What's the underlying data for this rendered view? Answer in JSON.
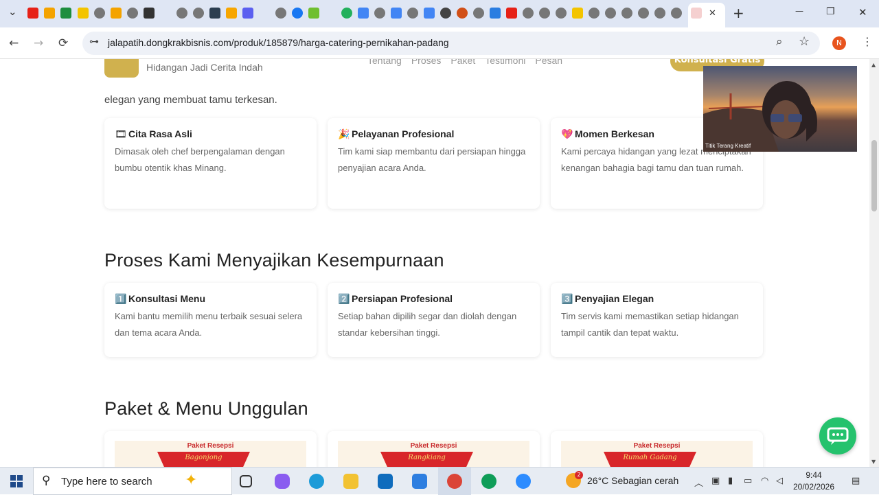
{
  "browser": {
    "url": "jalapatih.dongkrakbisnis.com/produk/185879/harga-catering-pernikahan-padang",
    "user_initial": "N",
    "controls": {
      "back": "←",
      "forward": "→",
      "reload": "⟳",
      "tune": "⊶",
      "zoom": "⌕",
      "star": "☆",
      "new_tab": "+",
      "minimize": "—",
      "restore": "❐",
      "close": "✕",
      "tab_menu": "⌄",
      "tab_close": "✕"
    }
  },
  "site": {
    "tagline": "Hidangan Jadi Cerita Indah",
    "nav": [
      "Tentang",
      "Proses",
      "Paket",
      "Testimoni",
      "Pesan"
    ],
    "cta": "Konsultasi Gratis"
  },
  "intro_tail": "elegan yang membuat tamu terkesan.",
  "features": [
    {
      "emoji": "🎞",
      "title": "Cita Rasa Asli",
      "text": "Dimasak oleh chef berpengalaman dengan bumbu otentik khas Minang."
    },
    {
      "emoji": "🎉",
      "title": "Pelayanan Profesional",
      "text": "Tim kami siap membantu dari persiapan hingga penyajian acara Anda."
    },
    {
      "emoji": "💖",
      "title": "Momen Berkesan",
      "text": "Kami percaya hidangan yang lezat menciptakan kenangan bahagia bagi tamu dan tuan rumah."
    }
  ],
  "process_title": "Proses Kami Menyajikan Kesempurnaan",
  "process": [
    {
      "emoji": "1️⃣",
      "title": "Konsultasi Menu",
      "text": "Kami bantu memilih menu terbaik sesuai selera dan tema acara Anda."
    },
    {
      "emoji": "2️⃣",
      "title": "Persiapan Profesional",
      "text": "Setiap bahan dipilih segar dan diolah dengan standar kebersihan tinggi."
    },
    {
      "emoji": "3️⃣",
      "title": "Penyajian Elegan",
      "text": "Tim servis kami memastikan setiap hidangan tampil cantik dan tepat waktu."
    }
  ],
  "packages_title": "Paket & Menu Unggulan",
  "packages": [
    {
      "label": "Paket Resepsi",
      "name": "Bagonjong"
    },
    {
      "label": "Paket Resepsi",
      "name": "Rangkiang"
    },
    {
      "label": "Paket Resepsi",
      "name": "Rumah Gadang"
    }
  ],
  "video_caption": "Titik Terang Kreatif",
  "taskbar": {
    "search_placeholder": "Type here to search",
    "weather": "26°C  Sebagian cerah",
    "weather_badge": "2",
    "time": "9:44",
    "date": "20/02/2026"
  },
  "colors": {
    "gold": "#c8a430",
    "chat_green": "#25c26d",
    "ribbon_red": "#d8262a"
  }
}
